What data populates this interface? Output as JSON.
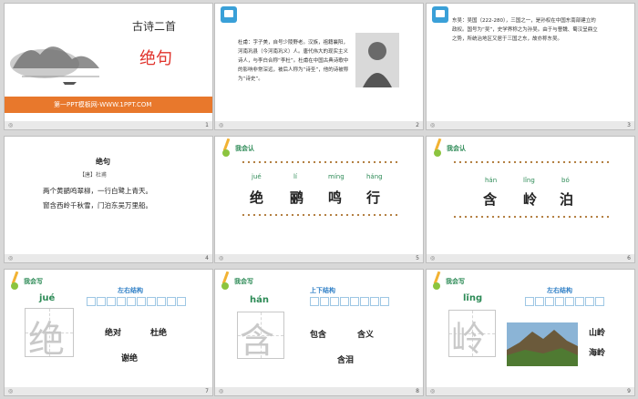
{
  "slides": [
    {
      "number": "1",
      "title": "古诗二首",
      "poem_title": "绝句",
      "footer": "第一PPT模板网-WWW.1PPT.COM"
    },
    {
      "number": "2",
      "text": "杜甫：字子美，自号少陵野老。汉族，祖籍襄阳，河南巩县（今河南巩义）人。唐代伟大的现实主义诗人，与李白合称“李杜”。杜甫在中国古典诗歌中的影响非常深远，被后人称为“诗圣”，他的诗被称为“诗史”。"
    },
    {
      "number": "3",
      "text": "东吴：吴国（222-280），三国之一，是孙权在中国东南部建立的政权。国号为“吴”，史学界称之为孙吴。由于与曹魏、蜀汉呈鼎立之势，所统治地区又居于三国之东，故亦称东吴。"
    },
    {
      "number": "4",
      "poem_title": "绝句",
      "author": "【唐】杜甫",
      "line1": "两个黄鹂鸣翠柳，一行白鹭上青天。",
      "line2": "窗含西岭千秋雪，门泊东吴万里船。"
    },
    {
      "number": "5",
      "heading": "我会认",
      "chars": [
        {
          "pinyin": "jué",
          "han": "绝"
        },
        {
          "pinyin": "lí",
          "han": "鹂"
        },
        {
          "pinyin": "míng",
          "han": "鸣"
        },
        {
          "pinyin": "háng",
          "han": "行"
        }
      ]
    },
    {
      "number": "6",
      "heading": "我会认",
      "chars": [
        {
          "pinyin": "hán",
          "han": "含"
        },
        {
          "pinyin": "lǐng",
          "han": "岭"
        },
        {
          "pinyin": "bó",
          "han": "泊"
        }
      ]
    },
    {
      "number": "7",
      "heading": "我会写",
      "structure": "左右结构",
      "pinyin": "jué",
      "han": "绝",
      "words": [
        "绝对",
        "杜绝",
        "谢绝"
      ]
    },
    {
      "number": "8",
      "heading": "我会写",
      "structure": "上下结构",
      "pinyin": "hán",
      "han": "含",
      "words": [
        "包含",
        "含义",
        "含泪"
      ]
    },
    {
      "number": "9",
      "heading": "我会写",
      "structure": "左右结构",
      "pinyin": "lǐng",
      "han": "岭",
      "words": [
        "山岭",
        "海岭"
      ]
    }
  ],
  "colors": {
    "orange": "#e8782c",
    "red": "#e0322b",
    "green": "#2e8b57",
    "blue": "#2f7fc6",
    "brown": "#b07a3a"
  },
  "icons": [
    "mountain-ink-painting",
    "portrait-image",
    "bookmark-badge",
    "pencil-boy-icon"
  ]
}
